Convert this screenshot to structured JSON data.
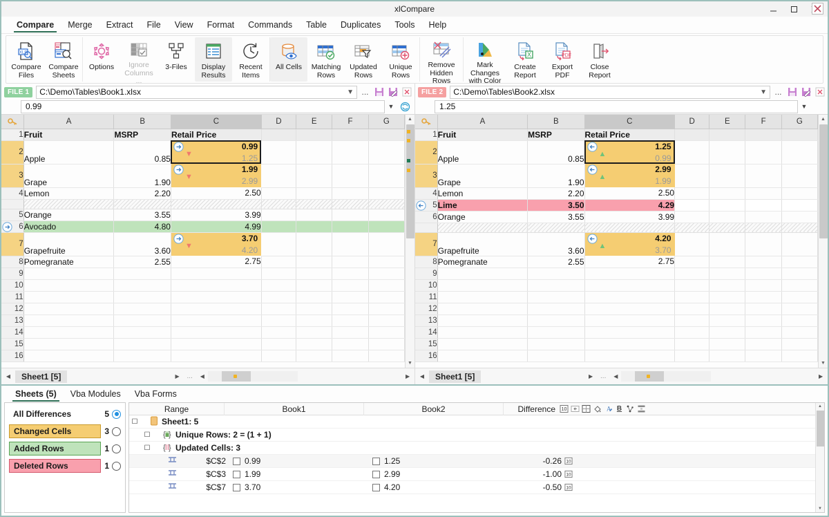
{
  "window": {
    "title": "xlCompare",
    "minimize": "minimize-icon",
    "maximize": "maximize-icon",
    "close": "close-icon"
  },
  "menu": {
    "items": [
      {
        "label": "Compare",
        "active": true
      },
      {
        "label": "Merge",
        "active": false
      },
      {
        "label": "Extract",
        "active": false
      },
      {
        "label": "File",
        "active": false
      },
      {
        "label": "View",
        "active": false
      },
      {
        "label": "Format",
        "active": false
      },
      {
        "label": "Commands",
        "active": false
      },
      {
        "label": "Table",
        "active": false
      },
      {
        "label": "Duplicates",
        "active": false
      },
      {
        "label": "Tools",
        "active": false
      },
      {
        "label": "Help",
        "active": false
      }
    ]
  },
  "ribbon": {
    "groups": [
      {
        "buttons": [
          {
            "label": "Compare\nFiles",
            "icon": "compare-files-icon",
            "state": "normal"
          },
          {
            "label": "Compare\nSheets",
            "icon": "compare-sheets-icon",
            "state": "normal"
          }
        ]
      },
      {
        "buttons": [
          {
            "label": "Options",
            "icon": "gear-icon",
            "state": "normal"
          },
          {
            "label": "Ignore\nColumns ...",
            "icon": "ignore-columns-icon",
            "state": "disabled"
          },
          {
            "label": "3-Files",
            "icon": "three-files-icon",
            "state": "normal"
          },
          {
            "label": "Display\nResults",
            "icon": "display-results-icon",
            "state": "selected"
          },
          {
            "label": "Recent\nItems",
            "icon": "recent-items-icon",
            "state": "normal"
          }
        ]
      },
      {
        "buttons": [
          {
            "label": "All Cells",
            "icon": "all-cells-icon",
            "state": "selected"
          },
          {
            "label": "Matching\nRows",
            "icon": "matching-rows-icon",
            "state": "normal"
          },
          {
            "label": "Updated\nRows",
            "icon": "updated-rows-icon",
            "state": "normal"
          },
          {
            "label": "Unique\nRows",
            "icon": "unique-rows-icon",
            "state": "normal"
          }
        ]
      },
      {
        "buttons": [
          {
            "label": "Remove\nHidden Rows",
            "icon": "remove-hidden-rows-icon",
            "state": "normal"
          }
        ]
      },
      {
        "buttons": [
          {
            "label": "Mark Changes\nwith Color",
            "icon": "mark-changes-icon",
            "state": "normal"
          },
          {
            "label": "Create\nReport",
            "icon": "create-report-icon",
            "state": "normal"
          },
          {
            "label": "Export\nPDF",
            "icon": "export-pdf-icon",
            "state": "normal"
          },
          {
            "label": "Close\nReport",
            "icon": "close-report-icon",
            "state": "normal"
          }
        ]
      }
    ]
  },
  "left_pane": {
    "file_tag": "FILE 1",
    "file_path": "C:\\Demo\\Tables\\Book1.xlsx",
    "formula_value": "0.99",
    "columns": [
      "A",
      "B",
      "C",
      "D",
      "E",
      "F",
      "G"
    ],
    "selected_column": "C",
    "sheet_tab": "Sheet1 [5]",
    "rows": [
      {
        "n": "1",
        "type": "header",
        "a": "Fruit",
        "b": "MSRP",
        "c": "Retail Price"
      },
      {
        "n": "2",
        "type": "changed",
        "a": "Apple",
        "b": "0.85",
        "c_new": "0.99",
        "c_old": "1.25",
        "focus": true,
        "dir": "down"
      },
      {
        "n": "3",
        "type": "changed",
        "a": "Grape",
        "b": "1.90",
        "c_new": "1.99",
        "c_old": "2.99",
        "focus": false,
        "dir": "down"
      },
      {
        "n": "4",
        "type": "normal",
        "a": "Lemon",
        "b": "2.20",
        "c": "2.50"
      },
      {
        "n": "",
        "type": "hatch"
      },
      {
        "n": "5",
        "type": "normal",
        "a": "Orange",
        "b": "3.55",
        "c": "3.99"
      },
      {
        "n": "6",
        "type": "added",
        "a": "Avocado",
        "b": "4.80",
        "c": "4.99",
        "arrow": "right-arrow-icon"
      },
      {
        "n": "7",
        "type": "changed",
        "a": "Grapefruite",
        "b": "3.60",
        "c_new": "3.70",
        "c_old": "4.20",
        "focus": false,
        "dir": "down"
      },
      {
        "n": "8",
        "type": "normal",
        "a": "Pomegranate",
        "b": "2.55",
        "c": "2.75"
      },
      {
        "n": "9",
        "type": "empty"
      },
      {
        "n": "10",
        "type": "empty"
      },
      {
        "n": "11",
        "type": "empty"
      },
      {
        "n": "12",
        "type": "empty"
      },
      {
        "n": "13",
        "type": "empty"
      },
      {
        "n": "14",
        "type": "empty"
      },
      {
        "n": "15",
        "type": "empty"
      },
      {
        "n": "16",
        "type": "empty"
      }
    ]
  },
  "right_pane": {
    "file_tag": "FILE 2",
    "file_path": "C:\\Demo\\Tables\\Book2.xlsx",
    "formula_value": "1.25",
    "columns": [
      "A",
      "B",
      "C",
      "D",
      "E",
      "F",
      "G"
    ],
    "selected_column": "C",
    "sheet_tab": "Sheet1 [5]",
    "rows": [
      {
        "n": "1",
        "type": "header",
        "a": "Fruit",
        "b": "MSRP",
        "c": "Retail Price"
      },
      {
        "n": "2",
        "type": "changed",
        "a": "Apple",
        "b": "0.85",
        "c_new": "1.25",
        "c_old": "0.99",
        "focus": true,
        "dir": "up"
      },
      {
        "n": "3",
        "type": "changed",
        "a": "Grape",
        "b": "1.90",
        "c_new": "2.99",
        "c_old": "1.99",
        "focus": false,
        "dir": "up"
      },
      {
        "n": "4",
        "type": "normal",
        "a": "Lemon",
        "b": "2.20",
        "c": "2.50"
      },
      {
        "n": "5",
        "type": "deleted",
        "a": "Lime",
        "b": "3.50",
        "c": "4.29",
        "arrow": "left-arrow-icon"
      },
      {
        "n": "6",
        "type": "normal",
        "a": "Orange",
        "b": "3.55",
        "c": "3.99"
      },
      {
        "n": "",
        "type": "hatch"
      },
      {
        "n": "7",
        "type": "changed",
        "a": "Grapefruite",
        "b": "3.60",
        "c_new": "4.20",
        "c_old": "3.70",
        "focus": false,
        "dir": "up"
      },
      {
        "n": "8",
        "type": "normal",
        "a": "Pomegranate",
        "b": "2.55",
        "c": "2.75"
      },
      {
        "n": "9",
        "type": "empty"
      },
      {
        "n": "10",
        "type": "empty"
      },
      {
        "n": "11",
        "type": "empty"
      },
      {
        "n": "12",
        "type": "empty"
      },
      {
        "n": "13",
        "type": "empty"
      },
      {
        "n": "14",
        "type": "empty"
      },
      {
        "n": "15",
        "type": "empty"
      },
      {
        "n": "16",
        "type": "empty"
      }
    ]
  },
  "bottom": {
    "tabs": [
      {
        "label": "Sheets (5)",
        "active": true
      },
      {
        "label": "Vba Modules",
        "active": false
      },
      {
        "label": "Vba Forms",
        "active": false
      }
    ],
    "legend": [
      {
        "label": "All Differences",
        "count": "5",
        "kind": "plain",
        "selected": true
      },
      {
        "label": "Changed Cells",
        "count": "3",
        "kind": "changed",
        "selected": false
      },
      {
        "label": "Added Rows",
        "count": "1",
        "kind": "added",
        "selected": false
      },
      {
        "label": "Deleted Rows",
        "count": "1",
        "kind": "deleted",
        "selected": false
      }
    ],
    "tree_headers": {
      "range": "Range",
      "book1": "Book1",
      "book2": "Book2",
      "difference": "Difference"
    },
    "tree_header_icons": [
      "number-format-icon",
      "indent-icon",
      "borders-icon",
      "fill-color-icon",
      "font-color-icon",
      "bold-icon",
      "formula-icon",
      "merge-icon"
    ],
    "tree": [
      {
        "depth": 0,
        "expander": "minus",
        "icon": "sheet-icon",
        "label": "Sheet1: 5"
      },
      {
        "depth": 1,
        "expander": "plus",
        "icon": "unique-rows-icon",
        "label": "Unique Rows: 2 = (1 + 1)"
      },
      {
        "depth": 1,
        "expander": "minus",
        "icon": "updated-cells-icon",
        "label": "Updated Cells: 3"
      },
      {
        "depth": 2,
        "expander": "",
        "icon": "cell-icon",
        "ref": "$C$2",
        "book1": "0.99",
        "book2": "1.25",
        "difference": "-0.26",
        "diff_icon": "number-format-icon"
      },
      {
        "depth": 2,
        "expander": "",
        "icon": "cell-icon",
        "ref": "$C$3",
        "book1": "1.99",
        "book2": "2.99",
        "difference": "-1.00",
        "diff_icon": "number-format-icon"
      },
      {
        "depth": 2,
        "expander": "",
        "icon": "cell-icon",
        "ref": "$C$7",
        "book1": "3.70",
        "book2": "4.20",
        "difference": "-0.50",
        "diff_icon": "number-format-icon"
      }
    ],
    "close_label": "close-panel-icon"
  },
  "colors": {
    "accent": "#2f6f56",
    "changed": "#f5cd72",
    "added": "#bfe3bb",
    "deleted": "#f9a0ad",
    "border": "#9cc0bb"
  }
}
